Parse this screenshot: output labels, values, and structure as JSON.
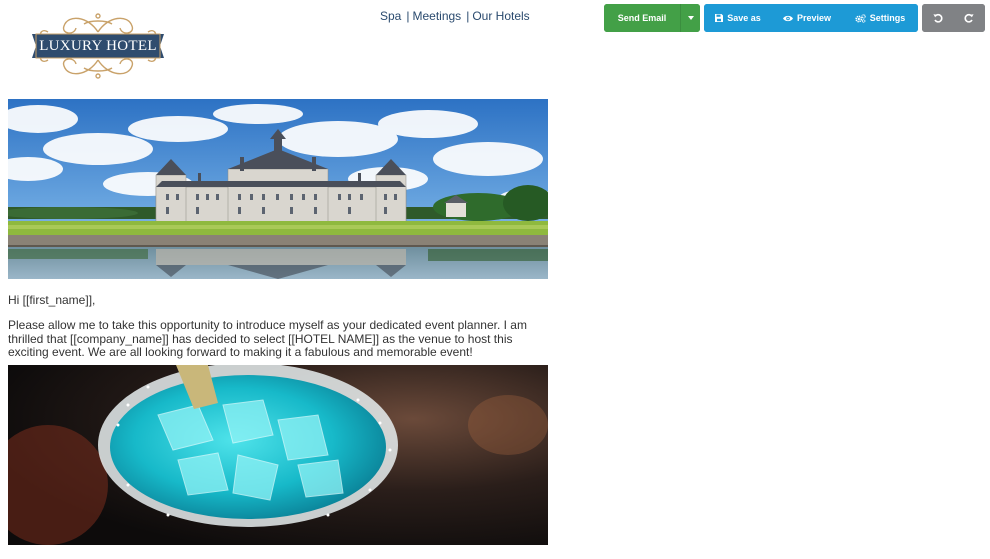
{
  "logo": {
    "text": "LUXURY HOTEL"
  },
  "nav": {
    "links": [
      "Spa",
      "Meetings",
      "Our Hotels"
    ],
    "separator": "|"
  },
  "toolbar": {
    "send_label": "Send Email",
    "save_as_label": "Save as",
    "preview_label": "Preview",
    "settings_label": "Settings"
  },
  "email": {
    "greeting": "Hi [[first_name]],",
    "intro": "Please allow me to take this opportunity to introduce myself as your dedicated event planner. I am thrilled that [[company_name]] has decided to select [[HOTEL NAME]] as the venue to host this exciting event. We are all looking forward to making it a fabulous and memorable event!"
  },
  "colors": {
    "send_green": "#43a047",
    "toolbar_blue": "#1d9ad6",
    "toolbar_gray": "#808285",
    "logo_navy": "#2f4c6e",
    "logo_gold": "#c9a26a",
    "nav_text": "#2a4a6e"
  }
}
